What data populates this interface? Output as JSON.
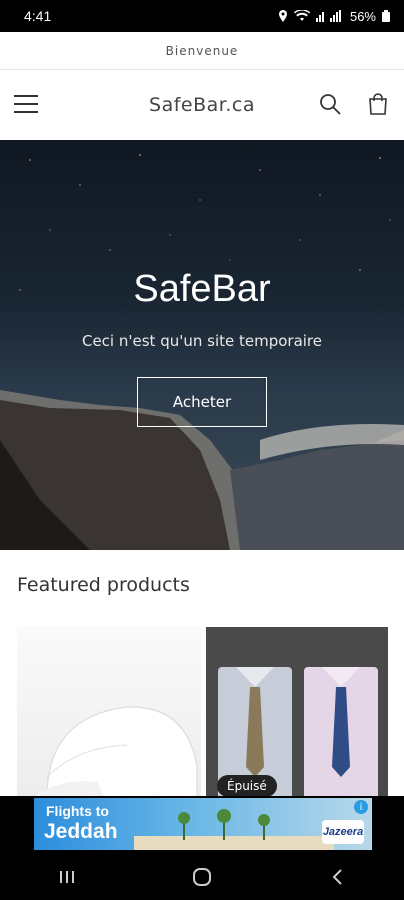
{
  "status": {
    "time": "4:41",
    "battery": "56%"
  },
  "announcement": "Bienvenue",
  "header": {
    "logo": "SafeBar.ca",
    "icons": [
      "menu-icon",
      "search-icon",
      "cart-icon"
    ]
  },
  "hero": {
    "title": "SafeBar",
    "subtitle": "Ceci n'est qu'un site temporaire",
    "button": "Acheter"
  },
  "featured": {
    "title": "Featured products",
    "badge": "Épuisé"
  },
  "ad": {
    "line1": "Flights to",
    "line2": "Jeddah",
    "brand": "Jazeera",
    "info": "i"
  },
  "colors": {
    "hero_dark": "#0f1722",
    "text_dark": "#333333",
    "ad_blue": "#2c8ddc"
  }
}
